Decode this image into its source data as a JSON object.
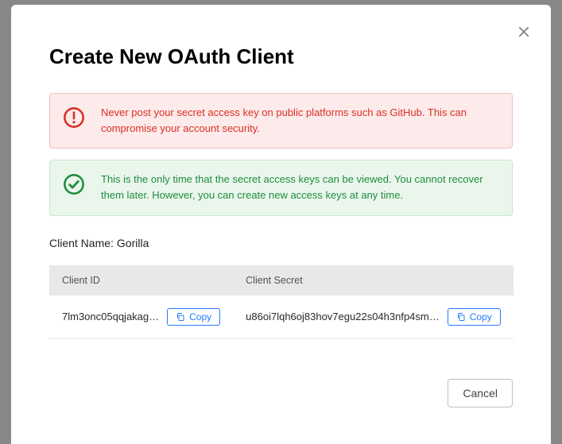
{
  "modal": {
    "title": "Create New OAuth Client",
    "alerts": {
      "warning": "Never post your secret access key on public platforms such as GitHub. This can compromise your account security.",
      "success": "This is the only time that the secret access keys can be viewed. You cannot recover them later. However, you can create new access keys at any time."
    },
    "client_name_label": "Client Name:",
    "client_name_value": "Gorilla",
    "table": {
      "headers": {
        "id": "Client ID",
        "secret": "Client Secret"
      },
      "row": {
        "client_id": "7lm3onc05qqjakag…",
        "client_secret": "u86oi7lqh6oj83hov7egu22s04h3nfp4sm…"
      },
      "copy_label": "Copy"
    },
    "footer": {
      "cancel": "Cancel"
    }
  }
}
